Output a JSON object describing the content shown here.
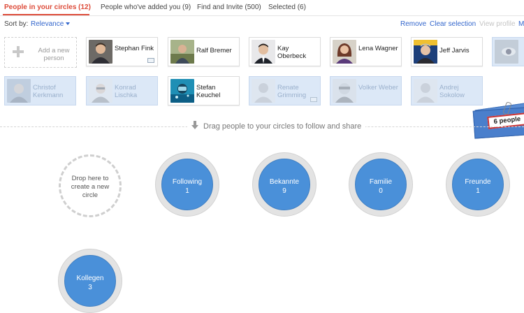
{
  "tabs": [
    {
      "label": "People in your circles (12)",
      "active": true
    },
    {
      "label": "People who've added you (9)"
    },
    {
      "label": "Find and Invite (500)"
    },
    {
      "label": "Selected (6)"
    }
  ],
  "toolbar": {
    "sort_label": "Sort by:",
    "sort_value": "Relevance",
    "remove": "Remove",
    "clear_selection": "Clear selection",
    "view_profile": "View profile",
    "more_truncated": "M"
  },
  "add_person": {
    "label": "Add a new person"
  },
  "people_row1": [
    {
      "name": "Stephan Fink"
    },
    {
      "name": "Ralf Bremer"
    },
    {
      "name": "Kay Oberbeck"
    },
    {
      "name": "Lena Wagner"
    },
    {
      "name": "Jeff Jarvis"
    }
  ],
  "people_row2": [
    {
      "name": "Christof Kerkmann",
      "selected": true
    },
    {
      "name": "Konrad Lischka",
      "selected": true
    },
    {
      "name": "Stefan Keuchel",
      "selected": false
    },
    {
      "name": "Renate Grimming",
      "selected": true
    },
    {
      "name": "Volker Weber",
      "selected": true
    },
    {
      "name": "Andrej Sokolow",
      "selected": true
    }
  ],
  "drag_hint": "Drag people to your circles to follow and share",
  "drag_badge": "6 people",
  "drop_circle": {
    "label": "Drop here to create a new circle"
  },
  "circles": [
    {
      "name": "Following",
      "count": "1"
    },
    {
      "name": "Bekannte",
      "count": "9"
    },
    {
      "name": "Familie",
      "count": "0"
    },
    {
      "name": "Freunde",
      "count": "1"
    },
    {
      "name": "Kollegen",
      "count": "3"
    }
  ],
  "colors": {
    "accent": "#dd4b39",
    "link": "#3366cc",
    "circle": "#4a90d9",
    "selected_bg": "#dce8f7"
  }
}
